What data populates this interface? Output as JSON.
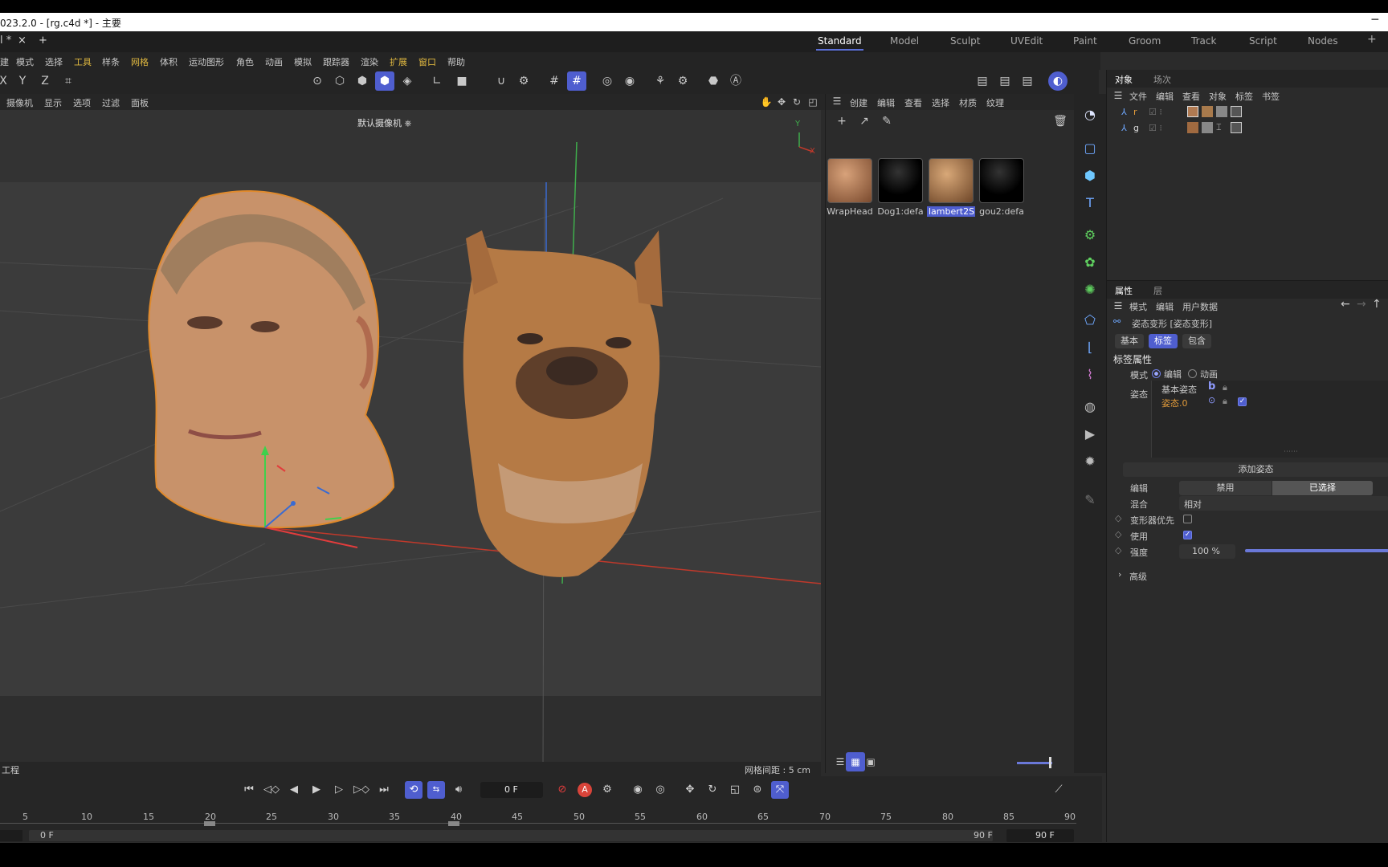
{
  "window": {
    "title": "023.2.0 - [rg.c4d *] - 主要",
    "min_glyph": "─"
  },
  "tabstrip": {
    "doc_tab": "l *",
    "close": "×",
    "add": "+"
  },
  "layouts": [
    "Standard",
    "Model",
    "Sculpt",
    "UVEdit",
    "Paint",
    "Groom",
    "Track",
    "Script",
    "Nodes"
  ],
  "layout_add": "+",
  "menubar": [
    "建",
    "模式",
    "选择",
    "工具",
    "样条",
    "网格",
    "体积",
    "运动图形",
    "角色",
    "动画",
    "模拟",
    "跟踪器",
    "渲染",
    "扩展",
    "窗口",
    "帮助"
  ],
  "axis_buttons": {
    "x": "X",
    "y": "Y",
    "z": "Z"
  },
  "viewport": {
    "menu": [
      "摄像机",
      "显示",
      "选项",
      "过滤",
      "面板"
    ],
    "camera_label": "默认摄像机 ⎈",
    "grid_info": "网格间距 : 5 cm",
    "footer_left": "工程",
    "axis_y": "Y",
    "axis_x": "X"
  },
  "material_manager": {
    "menu": [
      "创建",
      "编辑",
      "查看",
      "选择",
      "材质",
      "纹理"
    ],
    "materials": [
      {
        "name": "WrapHead",
        "color": "#b07a52"
      },
      {
        "name": "Dog1:defa",
        "color": "#080808"
      },
      {
        "name": "lambert2S",
        "color": "#a87a4c",
        "selected": true
      },
      {
        "name": "gou2:defa",
        "color": "#080808"
      }
    ]
  },
  "object_manager": {
    "tabs": [
      "对象",
      "场次"
    ],
    "menu": [
      "文件",
      "编辑",
      "查看",
      "对象",
      "标签",
      "书签"
    ],
    "objects": [
      {
        "name": "r"
      },
      {
        "name": "g"
      }
    ]
  },
  "attributes": {
    "tabs": [
      "属性",
      "层"
    ],
    "menu": [
      "模式",
      "编辑",
      "用户数据"
    ],
    "object_title": "姿态变形 [姿态变形]",
    "subtabs": [
      "基本",
      "标签",
      "包含"
    ],
    "section": "标签属性",
    "mode_label": "模式",
    "mode_edit": "编辑",
    "mode_anim": "动画",
    "pose_label": "姿态",
    "base_pose": "基本姿态",
    "base_pose_icon": "b",
    "pose0": "姿态.0",
    "add_pose": "添加姿态",
    "edit_label": "编辑",
    "edit_disable": "禁用",
    "edit_selected": "已选择",
    "blend_label": "混合",
    "blend_value": "相对",
    "deform_first": "变形器优先",
    "use_label": "使用",
    "strength_label": "强度",
    "strength_value": "100 %",
    "strength": 1.0,
    "advanced": "高级"
  },
  "timeline": {
    "current_frame": "0 F",
    "ticks": [
      "5",
      "10",
      "15",
      "20",
      "25",
      "30",
      "35",
      "40",
      "45",
      "50",
      "55",
      "60",
      "65",
      "70",
      "75",
      "80",
      "85",
      "90"
    ],
    "range_start": "0 F",
    "range_end": "90 F",
    "max_frame": "90 F"
  },
  "colors": {
    "accent": "#4f5ecf",
    "selection_orange": "#e08a2c",
    "pose_active": "#e09a3a"
  }
}
